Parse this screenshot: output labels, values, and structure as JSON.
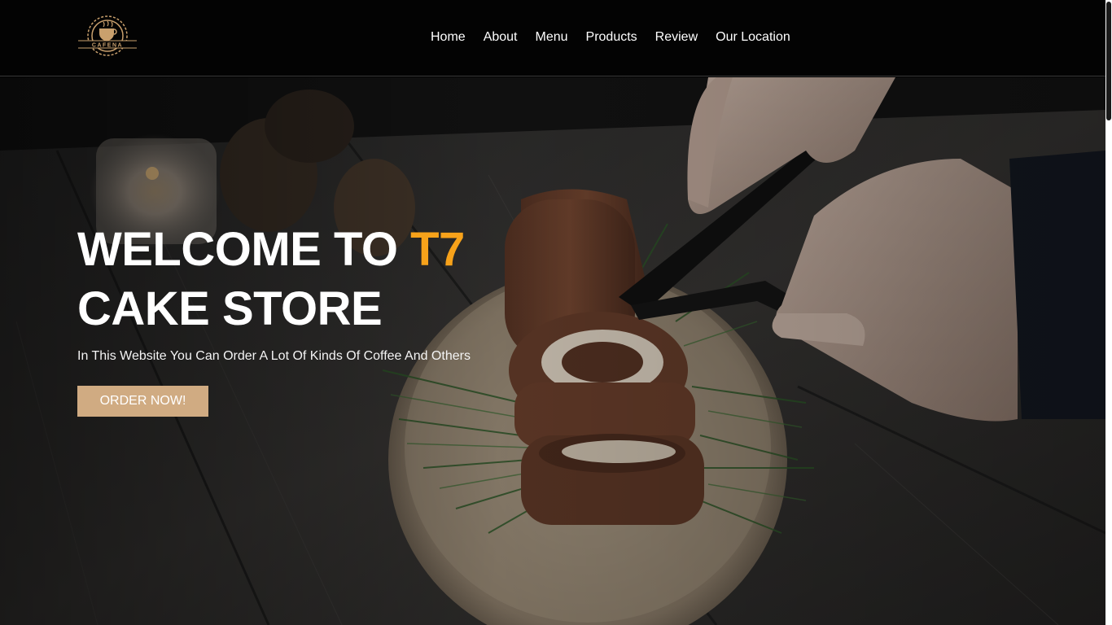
{
  "brand": {
    "logo_text": "CAFENA",
    "logo_color": "#d0ab82"
  },
  "nav": {
    "items": [
      {
        "label": "Home"
      },
      {
        "label": "About"
      },
      {
        "label": "Menu"
      },
      {
        "label": "Products"
      },
      {
        "label": "Review"
      },
      {
        "label": "Our Location"
      }
    ]
  },
  "hero": {
    "title_line1": "WELCOME TO ",
    "title_accent": "T7",
    "title_line2": "CAKE STORE",
    "subtitle": "In This Website You Can Order A Lot Of Kinds Of Coffee And Others",
    "cta_label": "ORDER NOW!",
    "accent_color": "#f7a21a",
    "cta_color": "#d0ab82"
  }
}
